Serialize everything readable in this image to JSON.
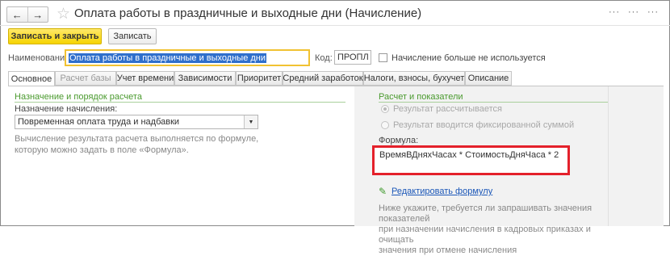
{
  "header": {
    "back_arrow": "←",
    "forward_arrow": "→",
    "star": "☆",
    "title": "Оплата работы в праздничные и выходные дни (Начисление)",
    "more1": "···",
    "more2": "···",
    "more3": "···"
  },
  "toolbar": {
    "save_close_label": "Записать и закрыть",
    "save_label": "Записать"
  },
  "form": {
    "name_label": "Наименование:",
    "name_value": "Оплата работы в праздничные и выходные дни",
    "code_label": "Код:",
    "code_value": "ПРОПЛ",
    "not_used_label": "Начисление больше не используется"
  },
  "tabs": [
    {
      "label": "Основное"
    },
    {
      "label": "Расчет базы"
    },
    {
      "label": "Учет времени"
    },
    {
      "label": "Зависимости"
    },
    {
      "label": "Приоритет"
    },
    {
      "label": "Средний заработок"
    },
    {
      "label": "Налоги, взносы, бухучет"
    },
    {
      "label": "Описание"
    }
  ],
  "left": {
    "section_title": "Назначение и порядок расчета",
    "purpose_label": "Назначение начисления:",
    "purpose_value": "Повременная оплата труда и надбавки",
    "note_line1": "Вычисление результата расчета выполняется по формуле,",
    "note_line2": "которую можно задать в поле «Формула»."
  },
  "right": {
    "section_title": "Расчет и показатели",
    "radio1": "Результат рассчитывается",
    "radio2": "Результат вводится фиксированной суммой",
    "formula_label": "Формула:",
    "formula_value": "ВремяВДняхЧасах * СтоимостьДняЧаса * 2",
    "edit_link": "Редактировать формулу",
    "note_line1": "Ниже укажите, требуется ли запрашивать значения показателей",
    "note_line2": "при назначении начисления в кадровых приказах и очищать",
    "note_line3": "значения при отмене начисления"
  },
  "colors": {
    "accent_yellow": "#f6d400",
    "green_title": "#4a9a2e",
    "highlight_red": "#e4212b",
    "selection_blue": "#2f6fcc"
  }
}
